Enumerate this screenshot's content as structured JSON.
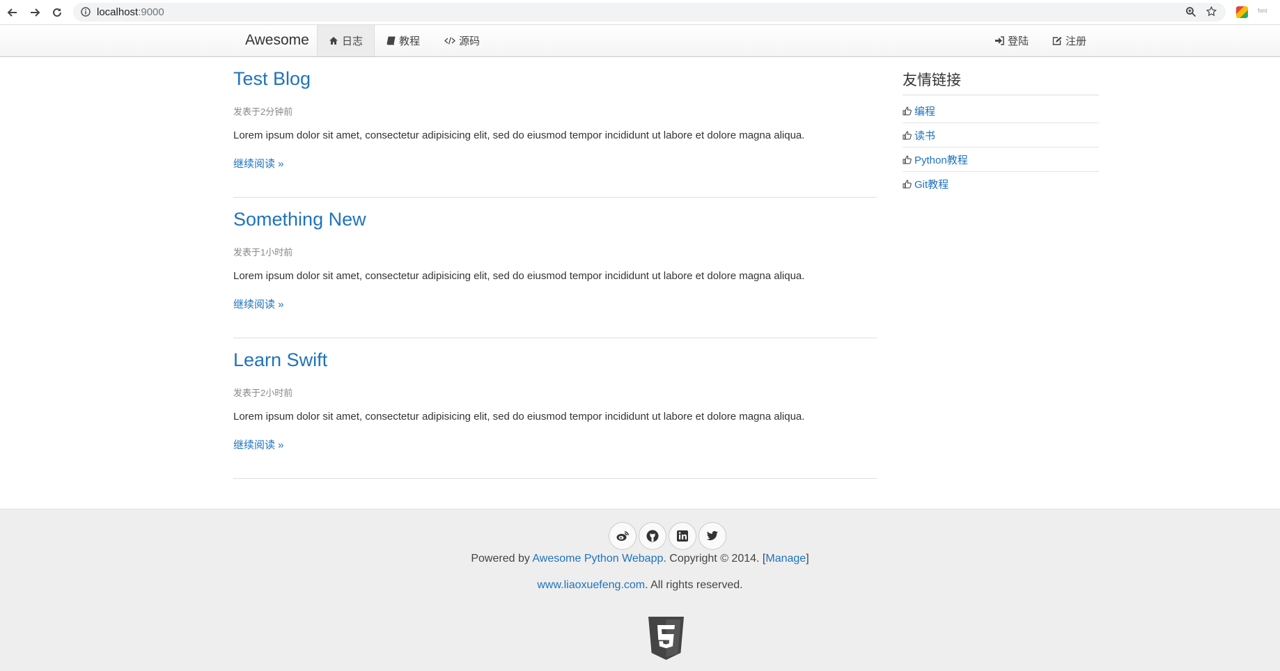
{
  "browser": {
    "url_host": "localhost",
    "url_port": ":9000",
    "extension_label": "font"
  },
  "navbar": {
    "brand": "Awesome",
    "items": [
      {
        "label": "日志",
        "icon": "home-icon",
        "active": true
      },
      {
        "label": "教程",
        "icon": "book-icon",
        "active": false
      },
      {
        "label": "源码",
        "icon": "code-icon",
        "active": false
      }
    ],
    "right_items": [
      {
        "label": "登陆",
        "icon": "sign-in-icon"
      },
      {
        "label": "注册",
        "icon": "edit-icon"
      }
    ]
  },
  "blogs": [
    {
      "title": "Test Blog",
      "meta": "发表于2分钟前",
      "summary": "Lorem ipsum dolor sit amet, consectetur adipisicing elit, sed do eiusmod tempor incididunt ut labore et dolore magna aliqua.",
      "more": "继续阅读 »"
    },
    {
      "title": "Something New",
      "meta": "发表于1小时前",
      "summary": "Lorem ipsum dolor sit amet, consectetur adipisicing elit, sed do eiusmod tempor incididunt ut labore et dolore magna aliqua.",
      "more": "继续阅读 »"
    },
    {
      "title": "Learn Swift",
      "meta": "发表于2小时前",
      "summary": "Lorem ipsum dolor sit amet, consectetur adipisicing elit, sed do eiusmod tempor incididunt ut labore et dolore magna aliqua.",
      "more": "继续阅读 »"
    }
  ],
  "sidebar": {
    "title": "友情链接",
    "links": [
      "编程",
      "读书",
      "Python教程",
      "Git教程"
    ]
  },
  "footer": {
    "social_icons": [
      "weibo-icon",
      "github-icon",
      "linkedin-icon",
      "twitter-icon"
    ],
    "powered_prefix": "Powered by ",
    "powered_link": "Awesome Python Webapp",
    "copyright": ". Copyright © 2014. [",
    "manage_link": "Manage",
    "bracket_close": "]",
    "site_link": "www.liaoxuefeng.com",
    "rights": ". All rights reserved.",
    "colors": {
      "link": "#1e73be",
      "background": "#eeeeee"
    }
  }
}
